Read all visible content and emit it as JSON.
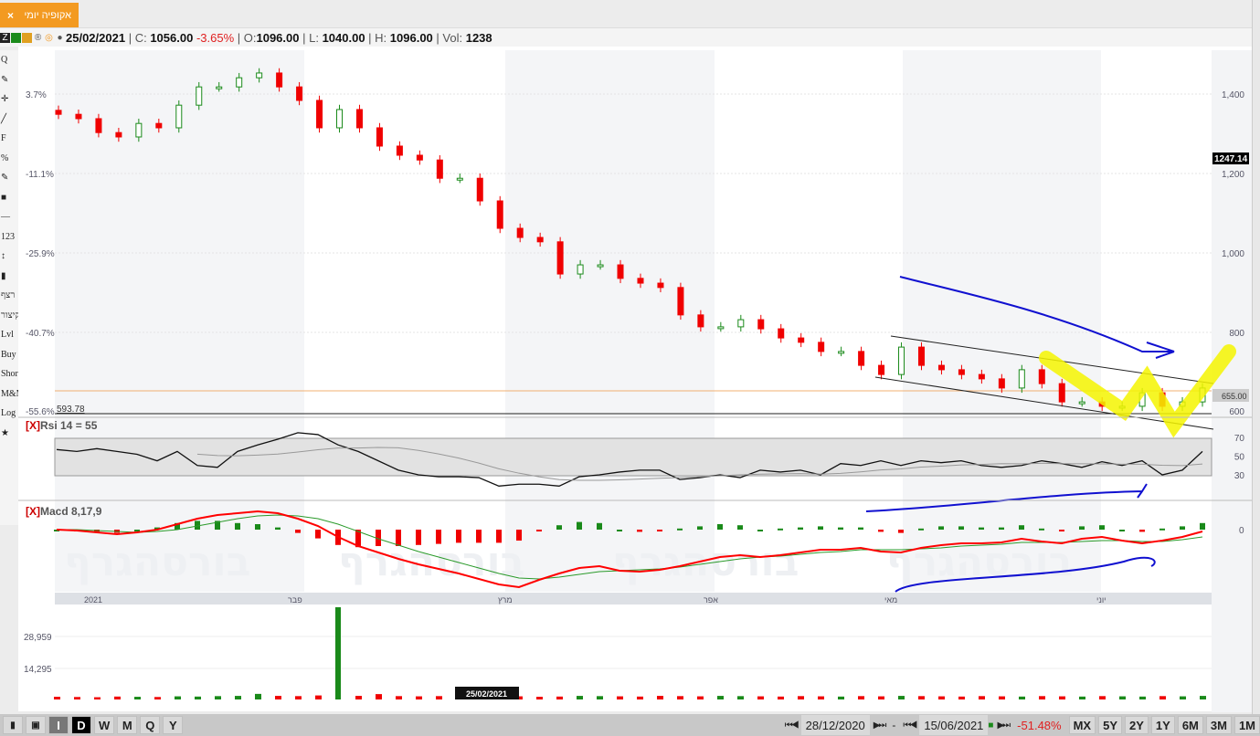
{
  "tab": {
    "title": "אקופיה יומי",
    "close": "×"
  },
  "info": {
    "date": "25/02/2021",
    "c_label": "C:",
    "close": "1056.00",
    "change": "-3.65%",
    "o_label": "O:",
    "open": "1096.00",
    "l_label": "L:",
    "low": "1040.00",
    "h_label": "H:",
    "high": "1096.00",
    "vol_label": "Vol:",
    "vol": "1238"
  },
  "toolbar": {
    "items": [
      "Q",
      "✎",
      "✛",
      "╱",
      "F",
      "%",
      "✎",
      "■",
      "—",
      "123",
      "↕",
      "▮",
      "רצף",
      "קיצור",
      "Lvl",
      "Buy",
      "Short",
      "M&M",
      "Log",
      "★"
    ]
  },
  "pct_axis": [
    "3.7%",
    "-11.1%",
    "-25.9%",
    "-40.7%",
    "-55.6%"
  ],
  "price_axis": [
    "1,400",
    "1,200",
    "1,000",
    "800",
    "600"
  ],
  "price_label": "1247.14",
  "last_price": "655.00",
  "support_label": "593.78",
  "rsi": {
    "close": "[X]",
    "title": "Rsi 14 = 55",
    "ticks": [
      "70",
      "50",
      "30"
    ],
    "values": [
      57,
      55,
      58,
      55,
      52,
      45,
      55,
      40,
      38,
      55,
      62,
      68,
      75,
      73,
      62,
      55,
      45,
      35,
      30,
      28,
      28,
      27,
      18,
      20,
      20,
      18,
      28,
      30,
      33,
      35,
      35,
      25,
      27,
      30,
      27,
      35,
      33,
      35,
      30,
      42,
      40,
      45,
      40,
      45,
      43,
      45,
      40,
      38,
      40,
      45,
      42,
      38,
      44,
      40,
      45,
      30,
      35,
      55
    ]
  },
  "macd": {
    "close": "[X]",
    "title": "Macd 8,17,9",
    "zero": "0",
    "line": [
      0,
      -1,
      -3,
      -5,
      -3,
      0,
      6,
      12,
      16,
      18,
      20,
      18,
      12,
      4,
      -8,
      -18,
      -25,
      -32,
      -38,
      -43,
      -48,
      -54,
      -60,
      -63,
      -55,
      -48,
      -42,
      -40,
      -45,
      -46,
      -44,
      -40,
      -35,
      -30,
      -28,
      -30,
      -28,
      -25,
      -22,
      -22,
      -20,
      -24,
      -25,
      -20,
      -17,
      -15,
      -15,
      -14,
      -10,
      -13,
      -15,
      -10,
      -8,
      -12,
      -15,
      -12,
      -8,
      -2
    ],
    "signal": [
      0,
      0,
      -1,
      -2,
      -3,
      -2,
      0,
      4,
      8,
      12,
      15,
      16,
      15,
      12,
      6,
      -2,
      -10,
      -17,
      -24,
      -30,
      -36,
      -42,
      -48,
      -53,
      -54,
      -52,
      -49,
      -46,
      -45,
      -44,
      -43,
      -41,
      -38,
      -35,
      -32,
      -30,
      -29,
      -27,
      -25,
      -24,
      -22,
      -22,
      -22,
      -21,
      -20,
      -18,
      -17,
      -16,
      -14,
      -14,
      -14,
      -13,
      -12,
      -12,
      -13,
      -13,
      -11,
      -8
    ]
  },
  "watermark": "בורסהגרף",
  "date_axis": [
    "2021",
    "פבר",
    "מרץ",
    "אפר",
    "מאי",
    "יוני"
  ],
  "volume": {
    "ticks": [
      "28,959",
      "14,295"
    ],
    "cursor_date": "25/02/2021",
    "values": [
      1200,
      1100,
      1000,
      1300,
      1200,
      1100,
      1400,
      1300,
      1500,
      1600,
      2500,
      1600,
      1500,
      1800,
      42000,
      1600,
      2400,
      1500,
      1400,
      1500,
      1300,
      1200,
      1300,
      1400,
      1200,
      1300,
      1600,
      1500,
      1400,
      1300,
      1600,
      1500,
      1400,
      1600,
      1500,
      1400,
      1300,
      1500,
      1400,
      1300,
      1500,
      1400,
      1600,
      1500,
      1400,
      1300,
      1500,
      1400,
      1300,
      1500,
      1400,
      1300,
      1500,
      1400,
      1300,
      1500,
      1400,
      1600
    ]
  },
  "candles": {
    "closes": [
      1349,
      1338,
      1303,
      1292,
      1326,
      1315,
      1372,
      1418,
      1418,
      1441,
      1453,
      1418,
      1384,
      1315,
      1361,
      1315,
      1269,
      1246,
      1234,
      1188,
      1188,
      1131,
      1062,
      1039,
      1028,
      947,
      970,
      970,
      936,
      924,
      913,
      844,
      814,
      814,
      832,
      809,
      786,
      775,
      752,
      752,
      717,
      694,
      763,
      717,
      706,
      694,
      683,
      660,
      706,
      671,
      625,
      625,
      614,
      614,
      648,
      614,
      625,
      660
    ]
  },
  "bottom": {
    "tools": [
      "I",
      "D",
      "W",
      "M",
      "Q",
      "Y"
    ],
    "start": "28/12/2020",
    "sep": "-",
    "end": "15/06/2021",
    "change": "-51.48%",
    "ranges": [
      "MX",
      "5Y",
      "2Y",
      "1Y",
      "6M",
      "3M",
      "1M"
    ]
  },
  "colors": {
    "up": "#1a8a1a",
    "down": "#f00000",
    "accent": "#f39a21",
    "annotation": "#1010d0",
    "highlight": "#f5f500"
  }
}
